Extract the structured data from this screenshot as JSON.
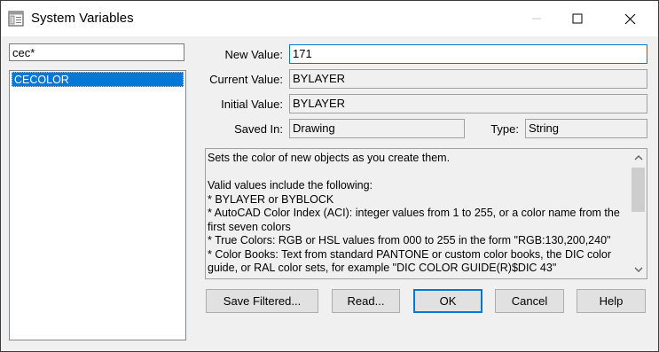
{
  "window": {
    "title": "System Variables",
    "controls": {
      "minimize_icon": "minimize-icon",
      "maximize_icon": "maximize-icon",
      "close_icon": "close-icon"
    }
  },
  "filter": {
    "value": "cec*"
  },
  "variables": {
    "items": [
      "CECOLOR"
    ],
    "selected": "CECOLOR"
  },
  "fields": {
    "new_value_label": "New Value:",
    "new_value": "171",
    "current_value_label": "Current Value:",
    "current_value": "BYLAYER",
    "initial_value_label": "Initial Value:",
    "initial_value": "BYLAYER",
    "saved_in_label": "Saved In:",
    "saved_in": "Drawing",
    "type_label": "Type:",
    "type": "String"
  },
  "description": {
    "text": "Sets the color of new objects as you create them.\n\nValid values include the following:\n* BYLAYER or BYBLOCK\n* AutoCAD Color Index (ACI): integer values from 1 to 255, or a color name from the first seven colors\n* True Colors: RGB or HSL values from 000 to 255 in the form \"RGB:130,200,240\"\n* Color Books: Text from standard PANTONE or custom color books, the DIC color guide, or RAL color sets, for example \"DIC COLOR GUIDE(R)$DIC 43\""
  },
  "buttons": {
    "save_filtered": "Save Filtered...",
    "read": "Read...",
    "ok": "OK",
    "cancel": "Cancel",
    "help": "Help"
  },
  "colors": {
    "selection": "#0078d7",
    "focus_border": "#0078d7"
  }
}
